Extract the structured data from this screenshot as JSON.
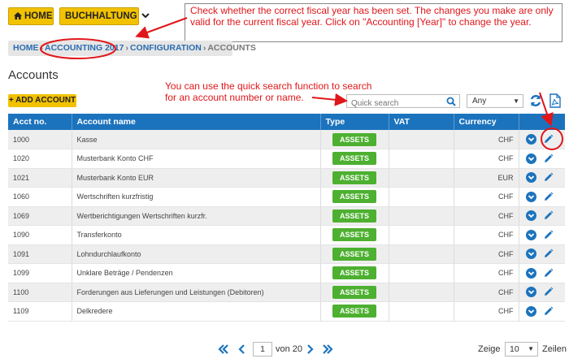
{
  "topnav": {
    "home_label": "HOME",
    "bookkeeping_label": "BUCHHALTUNG"
  },
  "notes": {
    "fiscal_year": "Check whether the correct fiscal year has been set. The changes you make are only valid for the current fiscal year. Click on \"Accounting [Year]\" to change the year.",
    "quick_search": "You can use the quick search function to search for an account number or name."
  },
  "breadcrumb": {
    "home": "HOME",
    "accounting": "ACCOUNTING 2017",
    "configuration": "CONFIGURATION",
    "current": "ACCOUNTS"
  },
  "page_title": "Accounts",
  "toolbar": {
    "add_label": "+ ADD ACCOUNT",
    "search_placeholder": "Quick search",
    "filter_value": "Any"
  },
  "table": {
    "headers": {
      "acct_no": "Acct no.",
      "name": "Account name",
      "type": "Type",
      "vat": "VAT",
      "currency": "Currency"
    },
    "rows": [
      {
        "no": "1000",
        "name": "Kasse",
        "type": "ASSETS",
        "vat": "",
        "currency": "CHF"
      },
      {
        "no": "1020",
        "name": "Musterbank Konto CHF",
        "type": "ASSETS",
        "vat": "",
        "currency": "CHF"
      },
      {
        "no": "1021",
        "name": "Musterbank Konto EUR",
        "type": "ASSETS",
        "vat": "",
        "currency": "EUR"
      },
      {
        "no": "1060",
        "name": "Wertschriften kurzfristig",
        "type": "ASSETS",
        "vat": "",
        "currency": "CHF"
      },
      {
        "no": "1069",
        "name": "Wertberichtigungen Wertschriften kurzfr.",
        "type": "ASSETS",
        "vat": "",
        "currency": "CHF"
      },
      {
        "no": "1090",
        "name": "Transferkonto",
        "type": "ASSETS",
        "vat": "",
        "currency": "CHF"
      },
      {
        "no": "1091",
        "name": "Lohndurchlaufkonto",
        "type": "ASSETS",
        "vat": "",
        "currency": "CHF"
      },
      {
        "no": "1099",
        "name": "Unklare Beträge / Pendenzen",
        "type": "ASSETS",
        "vat": "",
        "currency": "CHF"
      },
      {
        "no": "1100",
        "name": "Forderungen aus Lieferungen und Leistungen (Debitoren)",
        "type": "ASSETS",
        "vat": "",
        "currency": "CHF"
      },
      {
        "no": "1109",
        "name": "Delkredere",
        "type": "ASSETS",
        "vat": "",
        "currency": "CHF"
      }
    ]
  },
  "pagination": {
    "current_page": "1",
    "of_label": "von 20",
    "show_label": "Zeige",
    "rows_per_page": "10",
    "rows_label": "Zeilen"
  },
  "colors": {
    "accent_yellow": "#f2c200",
    "header_blue": "#1c73bd",
    "assets_green": "#4db030",
    "annotation_red": "#e0161a"
  },
  "icons": [
    "home-icon",
    "chevron-down-icon",
    "search-icon",
    "refresh-icon",
    "pdf-icon",
    "expand-icon",
    "pencil-icon",
    "first-page-icon",
    "prev-page-icon",
    "next-page-icon",
    "last-page-icon"
  ]
}
